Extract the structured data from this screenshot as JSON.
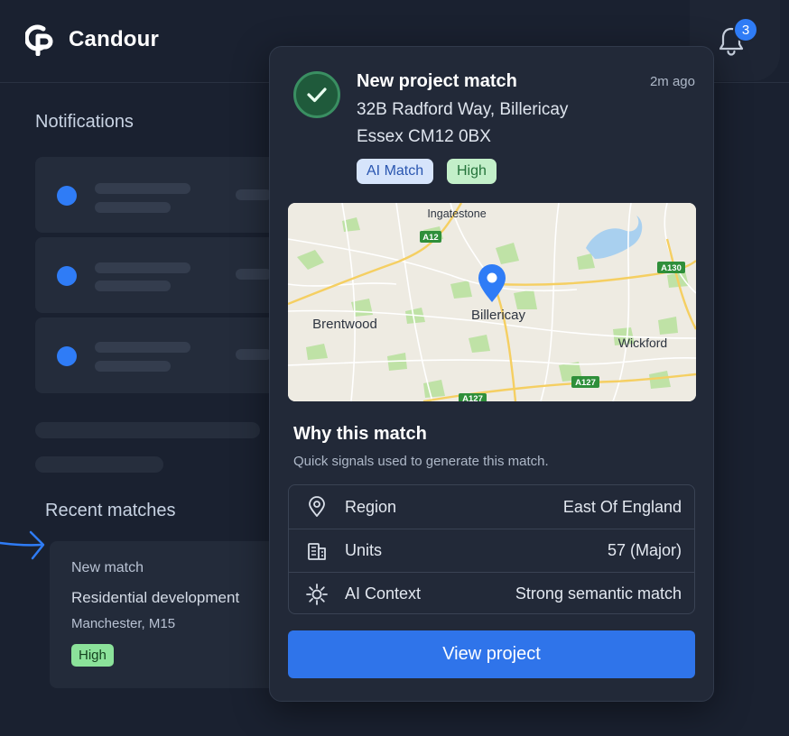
{
  "app": {
    "name": "Candour"
  },
  "header": {
    "notification_count": "3",
    "bell_icon": "bell-icon"
  },
  "left": {
    "notifications_title": "Notifications",
    "recent_matches_title": "Recent matches",
    "recent_match": {
      "kicker": "New match",
      "title": "Residential development",
      "location": "Manchester, M15",
      "tag": "High"
    }
  },
  "popover": {
    "title": "New project match",
    "time": "2m ago",
    "address_line1": "32B Radford Way, Billericay",
    "address_line2": "Essex CM12 0BX",
    "tags": {
      "ai": "AI Match",
      "priority": "High"
    },
    "map": {
      "labels": {
        "ingatestone": "Ingatestone",
        "brentwood": "Brentwood",
        "billericay": "Billericay",
        "wickford": "Wickford"
      },
      "roads": {
        "a12": "A12",
        "a130": "A130",
        "a127": "A127",
        "a127_bottom": "A127"
      }
    },
    "why_title": "Why this match",
    "why_subtitle": "Quick signals used to generate this match.",
    "signals": [
      {
        "icon": "location-pin-icon",
        "label": "Region",
        "value": "East Of England"
      },
      {
        "icon": "building-icon",
        "label": "Units",
        "value": "57 (Major)"
      },
      {
        "icon": "sparkle-icon",
        "label": "AI Context",
        "value": "Strong semantic match"
      }
    ],
    "cta": "View project"
  },
  "colors": {
    "background": "#1a2130",
    "accent": "#2f7cf6",
    "success": "#3a8f62",
    "tag_high_bg": "#c3efc9",
    "tag_ai_bg": "#d6e4fb"
  }
}
